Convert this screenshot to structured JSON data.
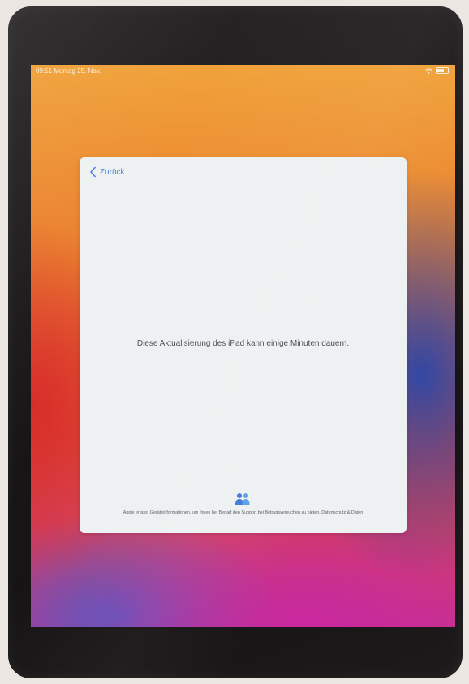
{
  "status_bar": {
    "time_date": "09:51 Montag 25. Nov."
  },
  "sheet": {
    "back_label": "Zurück",
    "message": "Diese Aktualisierung des iPad kann einige Minuten dauern.",
    "footer": "Apple erfasst Geräteinformationen, um Ihnen bei Bedarf den Support bei Betrugsversuchen zu bieten. Datenschutz & Daten"
  },
  "colors": {
    "accent": "#4a7fe0",
    "sheet_background": "#eef1f1"
  }
}
